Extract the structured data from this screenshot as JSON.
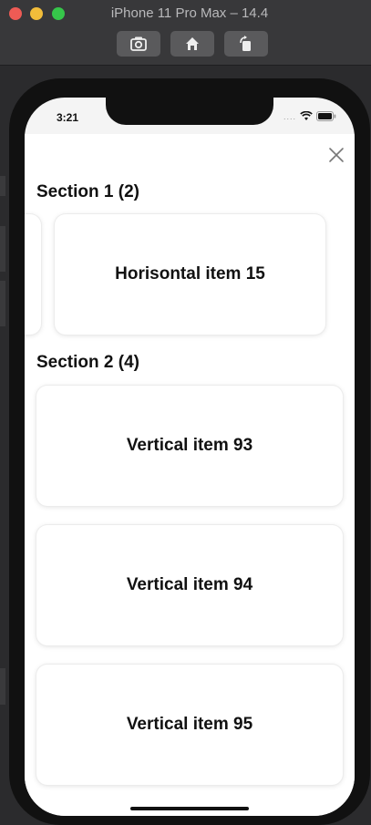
{
  "window": {
    "title": "iPhone 11 Pro Max – 14.4",
    "toolbar": {
      "screenshot_icon": "camera-icon",
      "home_icon": "home-icon",
      "rotate_icon": "rotate-icon"
    }
  },
  "status_bar": {
    "time": "3:21",
    "signal": "....",
    "wifi_icon": "wifi-icon",
    "battery_icon": "battery-icon"
  },
  "sheet": {
    "close_icon": "close-icon",
    "sections": [
      {
        "title": "Section 1 (2)",
        "items": [
          {
            "label": ""
          },
          {
            "label": "Horisontal item 15"
          }
        ]
      },
      {
        "title": "Section 2 (4)",
        "items": [
          {
            "label": "Vertical item 93"
          },
          {
            "label": "Vertical item 94"
          },
          {
            "label": "Vertical item 95"
          }
        ]
      }
    ]
  },
  "colors": {
    "background": "#2b2b2d",
    "card": "#ffffff",
    "text": "#111111"
  }
}
